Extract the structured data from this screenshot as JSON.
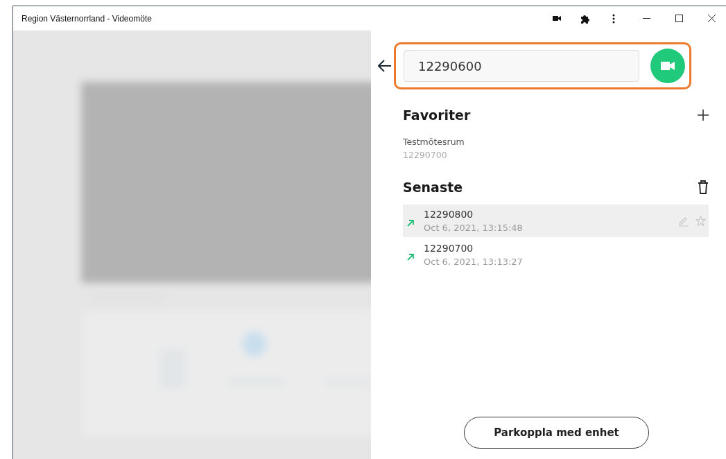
{
  "window": {
    "title": "Region Västernorrland - Videomöte"
  },
  "search": {
    "value": "12290600",
    "highlighted": true
  },
  "favorites": {
    "title": "Favoriter",
    "items": [
      {
        "name": "Testmötesrum",
        "number": "12290700"
      }
    ]
  },
  "recent": {
    "title": "Senaste",
    "items": [
      {
        "number": "12290800",
        "time": "Oct 6, 2021, 13:15:48",
        "selected": true
      },
      {
        "number": "12290700",
        "time": "Oct 6, 2021, 13:13:27",
        "selected": false
      }
    ]
  },
  "pair_button": "Parkoppla med enhet"
}
